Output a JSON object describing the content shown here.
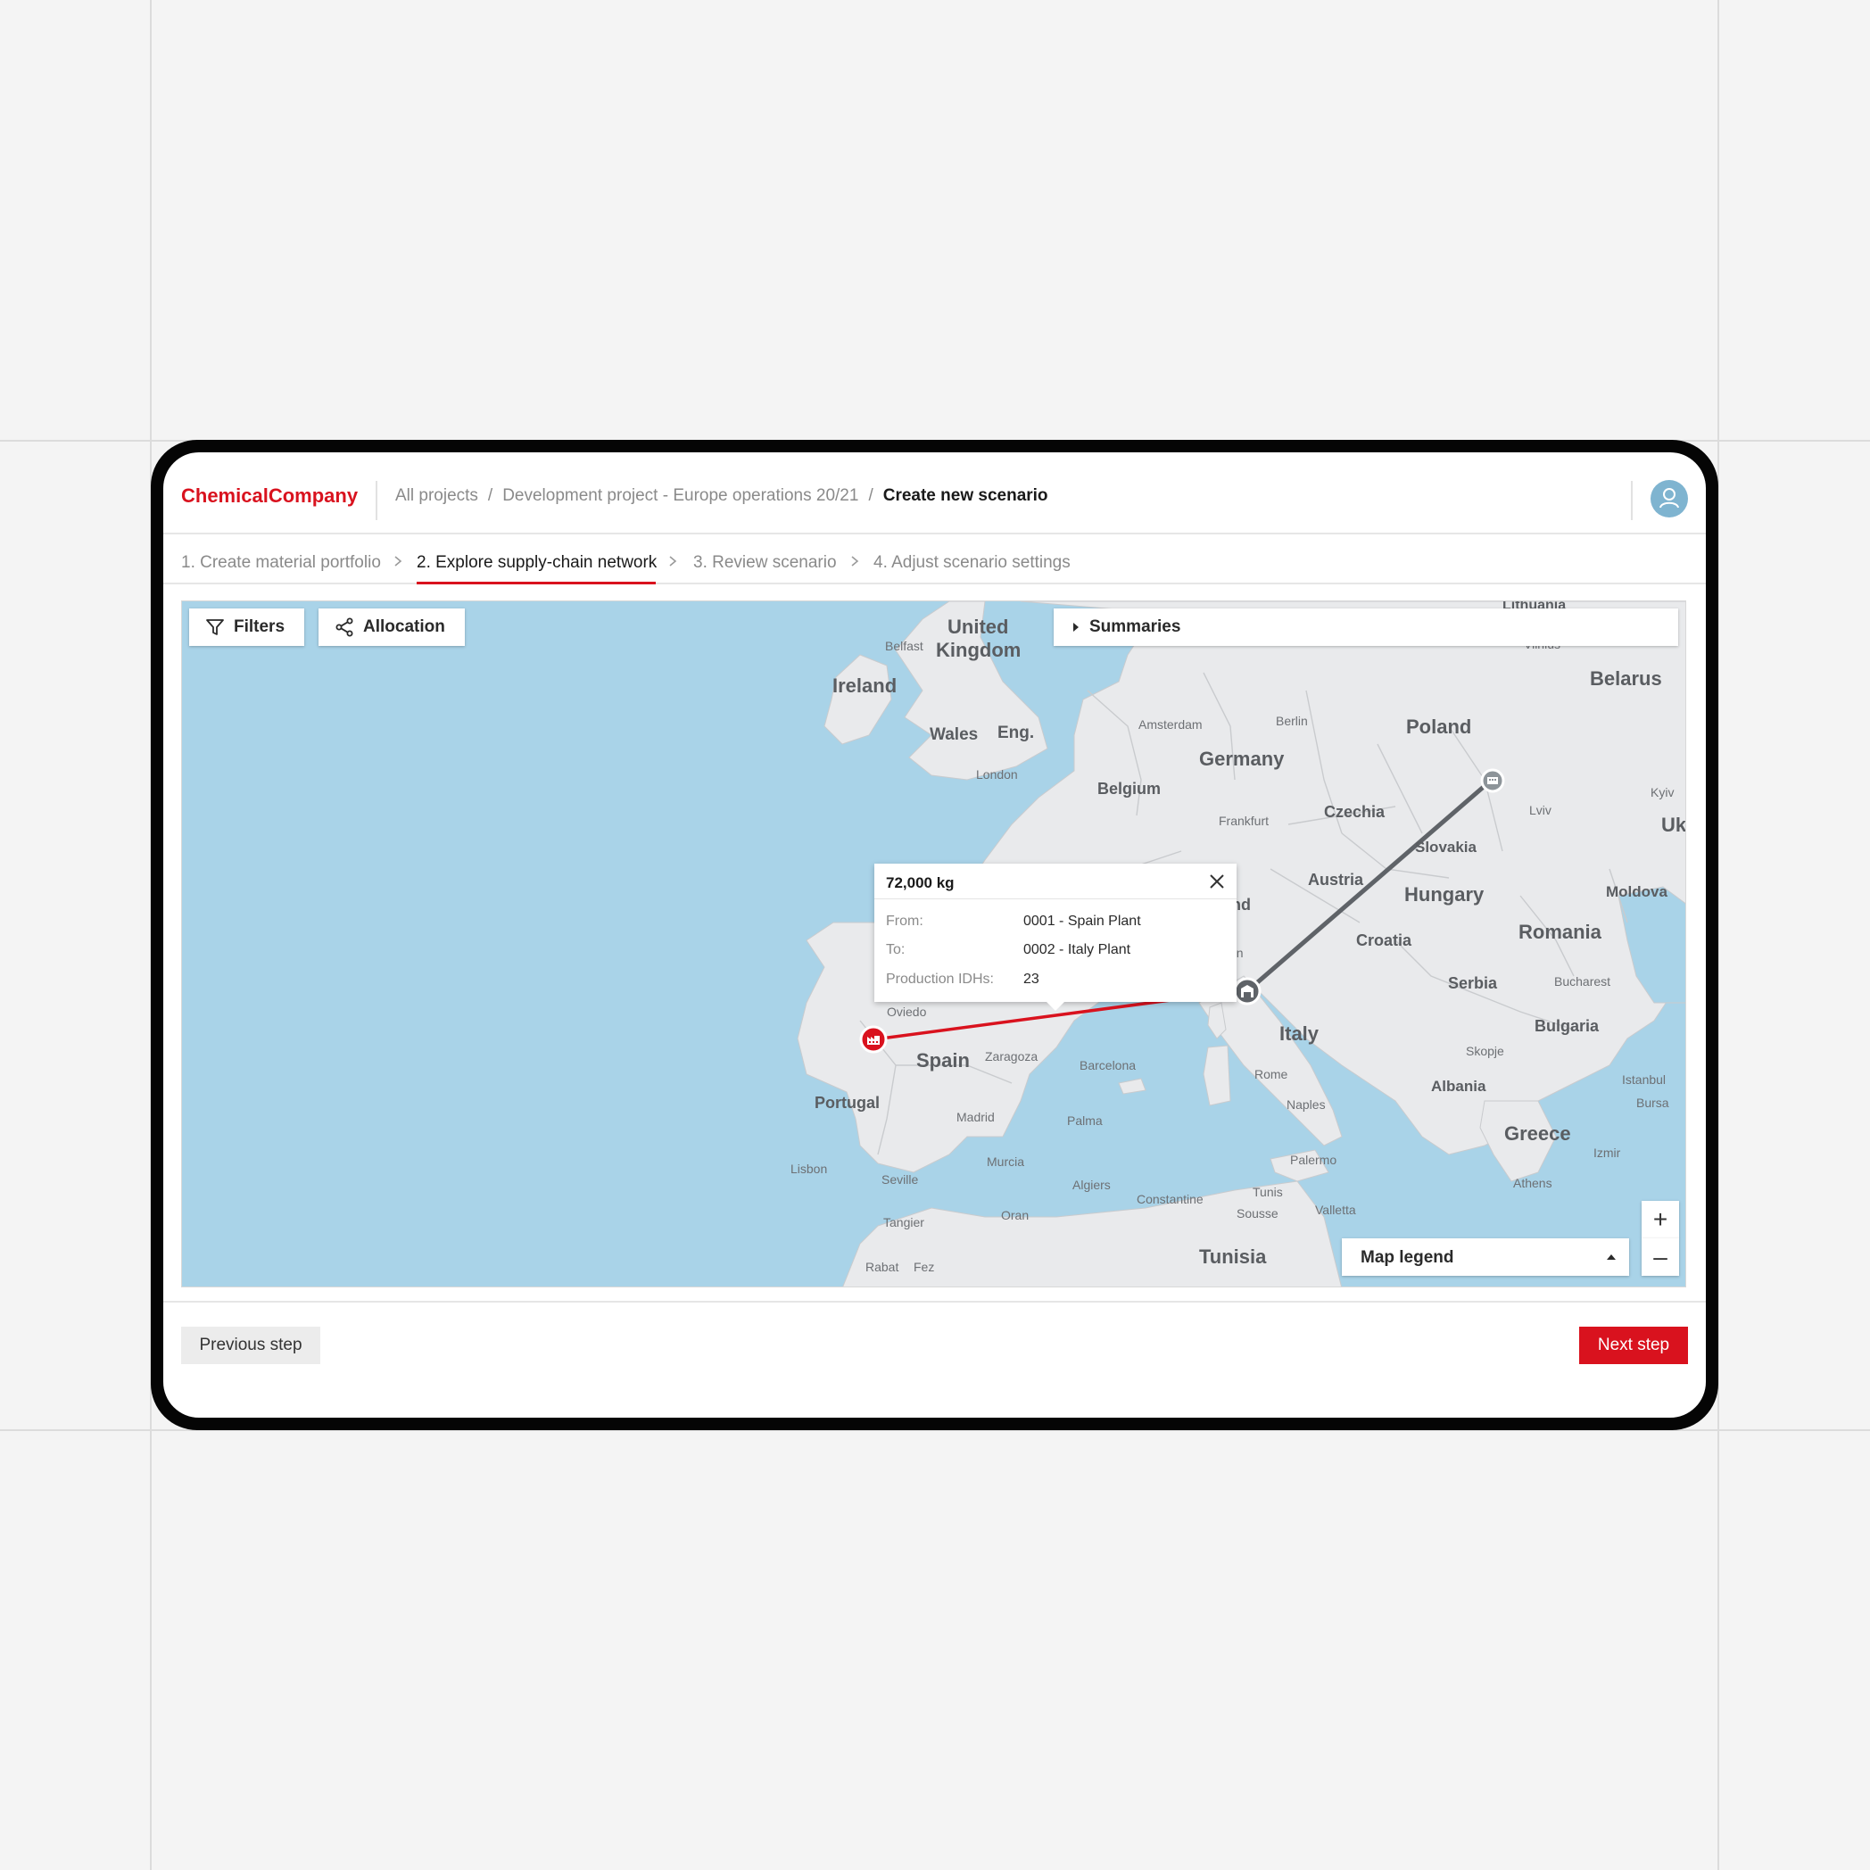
{
  "app": {
    "brand": "ChemicalCompany"
  },
  "breadcrumb": {
    "items": [
      "All projects",
      "Development project - Europe operations 20/21"
    ],
    "separator": "/",
    "current": "Create new scenario"
  },
  "steps": [
    {
      "label": "1. Create material portfolio",
      "active": false
    },
    {
      "label": "2. Explore supply-chain network",
      "active": true
    },
    {
      "label": "3. Review scenario",
      "active": false
    },
    {
      "label": "4. Adjust scenario settings",
      "active": false
    }
  ],
  "map": {
    "filters_label": "Filters",
    "allocation_label": "Allocation",
    "summaries_label": "Summaries",
    "legend_label": "Map legend",
    "zoom_in": "+",
    "zoom_out": "–",
    "countries": [
      "United",
      "Kingdom",
      "Ireland",
      "Wales",
      "Eng.",
      "Belgium",
      "Germany",
      "Poland",
      "Belarus",
      "Czechia",
      "Slovakia",
      "Austria",
      "Hungary",
      "Romania",
      "Moldova",
      "Croatia",
      "Serbia",
      "Bulgaria",
      "Italy",
      "Spain",
      "Portugal",
      "Albania",
      "Greece",
      "Tunisia",
      "Uk",
      "Lithuania",
      "nd"
    ],
    "cities": [
      "Belfast",
      "London",
      "Amsterdam",
      "Berlin",
      "Frankfurt",
      "Kyiv",
      "Lviv",
      "Bucharest",
      "Skopje",
      "Istanbul",
      "Bursa",
      "Izmir",
      "Athens",
      "Rome",
      "Naples",
      "Palermo",
      "Tunis",
      "Sousse",
      "Valletta",
      "Constantine",
      "Algiers",
      "Oran",
      "Barcelona",
      "Palma",
      "Murcia",
      "Madrid",
      "Zaragoza",
      "Oviedo",
      "Lisbon",
      "Seville",
      "Tangier",
      "Rabat",
      "Fez",
      "Vilnius",
      "an"
    ]
  },
  "popup": {
    "title": "72,000 kg",
    "rows": [
      {
        "key": "From:",
        "value": "0001 - Spain Plant"
      },
      {
        "key": "To:",
        "value": "0002 - Italy Plant"
      },
      {
        "key": "Production IDHs:",
        "value": "23"
      }
    ]
  },
  "footer": {
    "prev_label": "Previous step",
    "next_label": "Next step"
  },
  "colors": {
    "brand": "#d9121e",
    "sea": "#a9d3e8",
    "land": "#e9eaec",
    "route_active": "#d9121e",
    "route_inactive": "#5f6368"
  },
  "icons": [
    "user-icon",
    "filter-icon",
    "share-icon",
    "caret-right-icon",
    "caret-up-icon",
    "close-icon",
    "chevron-right-icon",
    "factory-icon",
    "warehouse-icon"
  ]
}
